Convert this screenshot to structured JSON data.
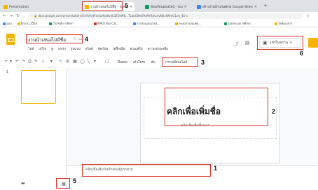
{
  "tabs": [
    {
      "label": "Presentation - ชื่อ สกุล",
      "color": "#f4b400",
      "active": false
    },
    {
      "label": "งานนำเสนอไม่มีชื่อ - Google สไลด์",
      "color": "#f4b400",
      "active": true
    },
    {
      "label": "ห้องเรียนออนไลน์ - Google ไดรฟ์",
      "color": "#0f9d58",
      "active": false
    },
    {
      "label": "สร้างงานนำเสนอด้วย Google Slides",
      "color": "#4285f4",
      "active": false
    }
  ],
  "address": {
    "url": "docs.google.com/presentation/d/1VVm4Fw4uHbs8vkLQE3hMB...TLabGWe39xMAktsLeyNXnN9mG1vA_4E-x"
  },
  "bookmarks": [
    "แอป",
    "ฝึกงาน 2563",
    "เว็บไซต์การศึกษา",
    "KPRU ห้อง Cal...",
    "การสอนออนไลน์...",
    "ระบบสารสนเทศ...",
    "นวัตกรรมการศึกษา",
    "ไฟล์เอกสาร"
  ],
  "doc": {
    "title": "งานนำเสนอไม่มีชื่อ",
    "menus": [
      "ไฟล์",
      "แก้ไข",
      "ดู",
      "แทรก",
      "รูปแบบ",
      "สไลด์",
      "จัดเรียง",
      "เครื่องมือ",
      "ส่วนเสริม",
      "ความช่วยเหลือ"
    ],
    "share_label": "แชร์ในสถาน",
    "toolbar_background": "พื้นหลัง",
    "toolbar_layout": "เค้าโครง",
    "toolbar_theme": "ธีม",
    "toolbar_transition": "การเปลี่ยนสไลด์"
  },
  "slide": {
    "number": "1",
    "title_placeholder": "คลิกเพื่อเพิ่มชื่อ",
    "subtitle_placeholder": "คลิกเพื่อเพิ่มชื่อรอง"
  },
  "notes": {
    "placeholder": "คลิกเพื่อเพิ่มบันทึกของผู้บรรยาย"
  },
  "annotations": [
    "1",
    "2",
    "3",
    "4",
    "5",
    "5",
    "6"
  ],
  "colors": {
    "slides_yellow": "#f4b400",
    "highlight_red": "#d93025"
  },
  "icons": [
    "back-icon",
    "forward-icon",
    "reload-icon",
    "lock-icon",
    "star-icon",
    "menu-icon",
    "grid-view-icon",
    "filmstrip-view-icon",
    "comment-icon",
    "present-icon"
  ]
}
